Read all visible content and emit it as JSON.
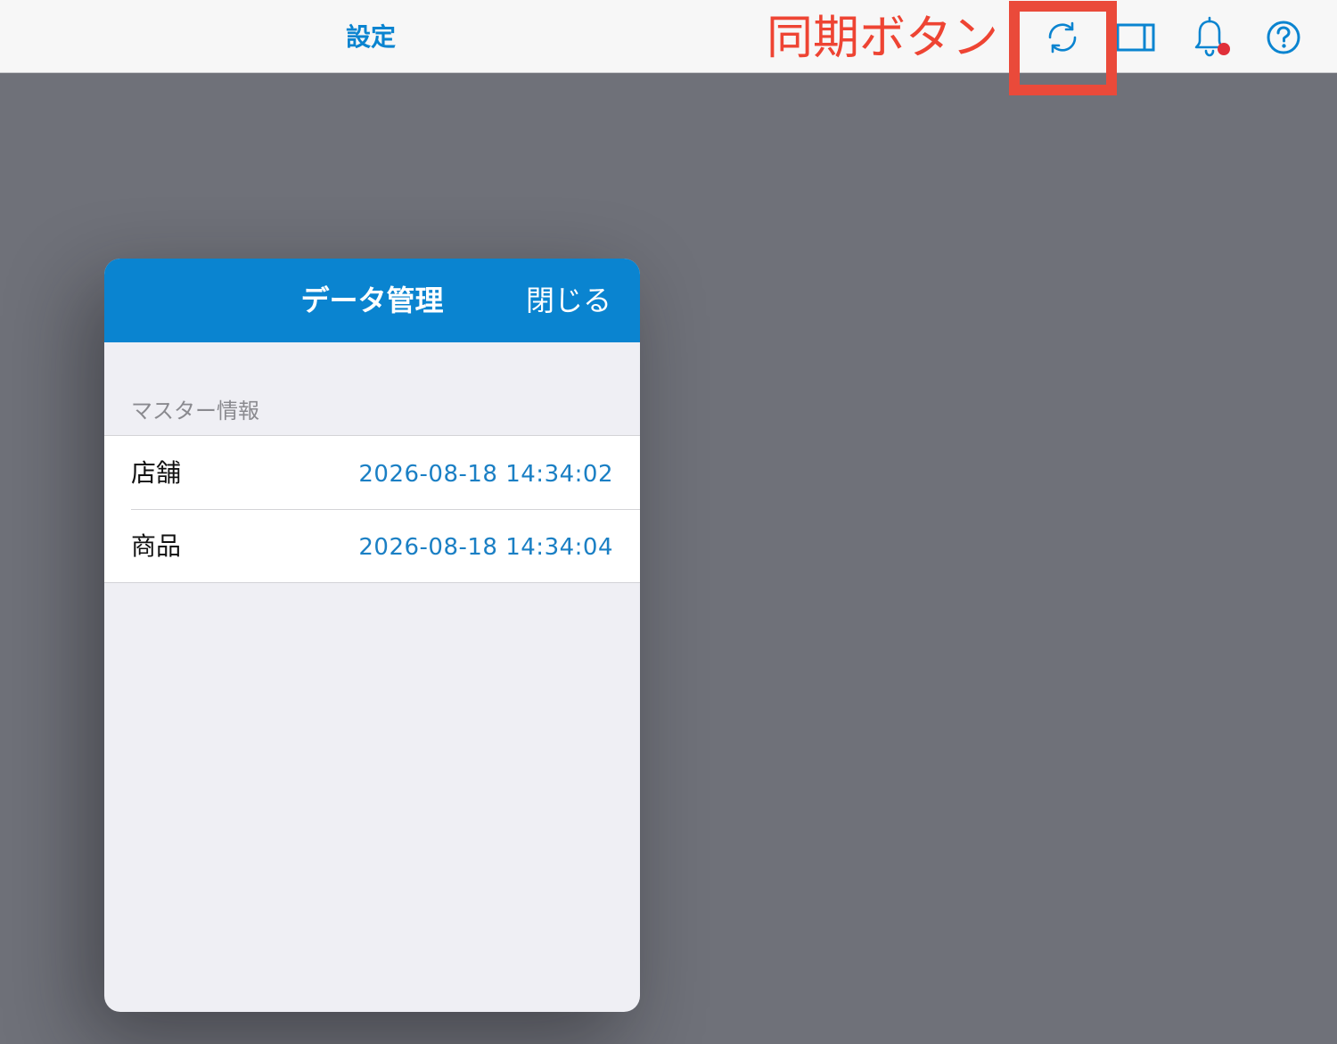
{
  "topbar": {
    "title": "設定",
    "icons": {
      "sync": "sync-icon",
      "sidebar": "sidebar-panel-icon",
      "notification": "bell-icon",
      "help": "help-icon"
    },
    "notification_badge_color": "#e0303a"
  },
  "annotation": {
    "label": "同期ボタン",
    "color": "#ea4a3a"
  },
  "modal": {
    "title": "データ管理",
    "close_label": "閉じる",
    "section_header": "マスター情報",
    "rows": [
      {
        "label": "店舗",
        "value": "2026-08-18 14:34:02"
      },
      {
        "label": "商品",
        "value": "2026-08-18 14:34:04"
      }
    ]
  },
  "colors": {
    "accent": "#0a84d0",
    "backdrop": "#6f7179",
    "value_text": "#1a7fc4"
  }
}
